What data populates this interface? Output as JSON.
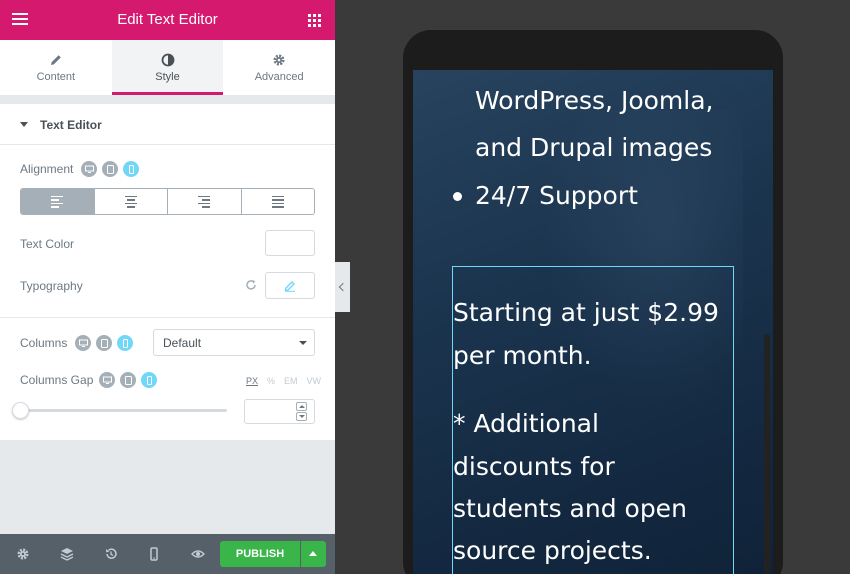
{
  "header": {
    "title": "Edit Text Editor"
  },
  "tabs": [
    {
      "label": "Content",
      "icon": "pencil-icon"
    },
    {
      "label": "Style",
      "icon": "half-circle-icon"
    },
    {
      "label": "Advanced",
      "icon": "gear-icon"
    }
  ],
  "section": {
    "title": "Text Editor"
  },
  "controls": {
    "alignment_label": "Alignment",
    "text_color_label": "Text Color",
    "typography_label": "Typography",
    "columns_label": "Columns",
    "columns_value": "Default",
    "columns_gap_label": "Columns Gap",
    "units": [
      "PX",
      "%",
      "EM",
      "VW"
    ]
  },
  "footer": {
    "publish_label": "PUBLISH"
  },
  "preview": {
    "line1": "WordPress,  Joomla,",
    "line2": "and Drupal images",
    "bullet_text": "24/7 Support",
    "price_line1": "Starting at just $2.99",
    "price_line2": "per month.",
    "note_line1": "* Additional",
    "note_line2": "discounts for",
    "note_line3": "students and open",
    "note_line4": "source projects."
  },
  "colors": {
    "brand": "#d5196e",
    "publish": "#39b54a",
    "responsive_active": "#71d7f7"
  }
}
